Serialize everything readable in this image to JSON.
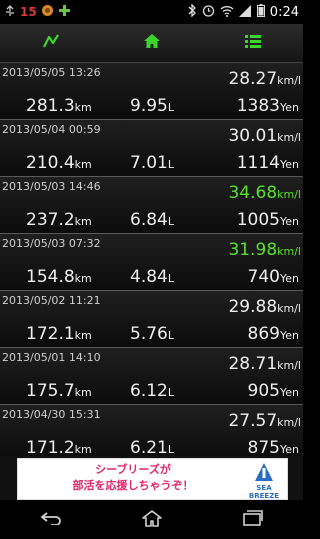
{
  "status": {
    "number": "15",
    "time": "0:24",
    "icons": [
      "usb-icon",
      "badge-icon",
      "plus-icon",
      "bluetooth-icon",
      "alarm-icon",
      "wifi-icon",
      "signal-icon",
      "battery-icon"
    ]
  },
  "toolbar": {
    "buttons": [
      "chart-icon",
      "home-icon",
      "list-icon"
    ],
    "accent": "#3bd62a"
  },
  "entries": [
    {
      "date": "2013/05/05 13:26",
      "efficiency": "28.27",
      "eff_unit": "km/l",
      "distance": "281.3",
      "dist_unit": "km",
      "fuel": "9.95",
      "fuel_unit": "L",
      "cost": "1383",
      "cost_unit": "Yen",
      "highlight": false
    },
    {
      "date": "2013/05/04 00:59",
      "efficiency": "30.01",
      "eff_unit": "km/l",
      "distance": "210.4",
      "dist_unit": "km",
      "fuel": "7.01",
      "fuel_unit": "L",
      "cost": "1114",
      "cost_unit": "Yen",
      "highlight": false
    },
    {
      "date": "2013/05/03 14:46",
      "efficiency": "34.68",
      "eff_unit": "km/l",
      "distance": "237.2",
      "dist_unit": "km",
      "fuel": "6.84",
      "fuel_unit": "L",
      "cost": "1005",
      "cost_unit": "Yen",
      "highlight": true
    },
    {
      "date": "2013/05/03 07:32",
      "efficiency": "31.98",
      "eff_unit": "km/l",
      "distance": "154.8",
      "dist_unit": "km",
      "fuel": "4.84",
      "fuel_unit": "L",
      "cost": "740",
      "cost_unit": "Yen",
      "highlight": true
    },
    {
      "date": "2013/05/02 11:21",
      "efficiency": "29.88",
      "eff_unit": "km/l",
      "distance": "172.1",
      "dist_unit": "km",
      "fuel": "5.76",
      "fuel_unit": "L",
      "cost": "869",
      "cost_unit": "Yen",
      "highlight": false
    },
    {
      "date": "2013/05/01 14:10",
      "efficiency": "28.71",
      "eff_unit": "km/l",
      "distance": "175.7",
      "dist_unit": "km",
      "fuel": "6.12",
      "fuel_unit": "L",
      "cost": "905",
      "cost_unit": "Yen",
      "highlight": false
    },
    {
      "date": "2013/04/30 15:31",
      "efficiency": "27.57",
      "eff_unit": "km/l",
      "distance": "171.2",
      "dist_unit": "km",
      "fuel": "6.21",
      "fuel_unit": "L",
      "cost": "875",
      "cost_unit": "Yen",
      "highlight": false
    }
  ],
  "ad": {
    "line1": "シーブリーズが",
    "line2": "部活を応援しちゃうぞ！",
    "logo_text": "SEA BREEZE",
    "color": "#e0296b"
  },
  "nav": [
    "back-icon",
    "home-icon",
    "recent-apps-icon"
  ]
}
